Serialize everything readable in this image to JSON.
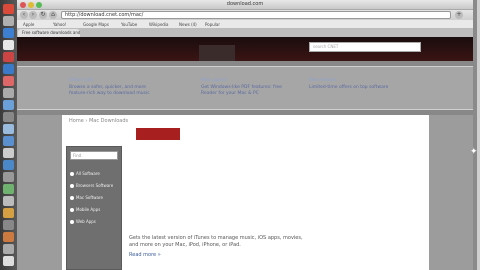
{
  "browser": {
    "title": "download.com",
    "url": "http://download.cnet.com/mac/",
    "tab_label": "Free software downloads and soft...",
    "bookmarks": [
      "Apple",
      "Yahoo!",
      "Google Maps",
      "YouTube",
      "Wikipedia",
      "News (4)",
      "Popular"
    ]
  },
  "site": {
    "search_placeholder": "search CNET",
    "promos": [
      {
        "heading": "Editors' pick",
        "text": "Browse a safer, quicker, and more feature-rich way to download music"
      },
      {
        "heading": "Most popular",
        "text": "Get Windows-like PDF features: free Reader for your Mac & PC"
      },
      {
        "heading": "New releases",
        "text": "Limited-time offers on top software"
      }
    ],
    "breadcrumb": "Home › Mac Downloads",
    "filter": {
      "input_placeholder": "Find",
      "options": [
        "All Software",
        "Browsers Software",
        "Mac Software",
        "Mobile Apps",
        "Web Apps"
      ]
    },
    "article": {
      "text": "Gets the latest version of iTunes to manage music, iOS apps, movies, and more on your Mac, iPod, iPhone, or iPad.",
      "read_more": "Read more »"
    }
  }
}
